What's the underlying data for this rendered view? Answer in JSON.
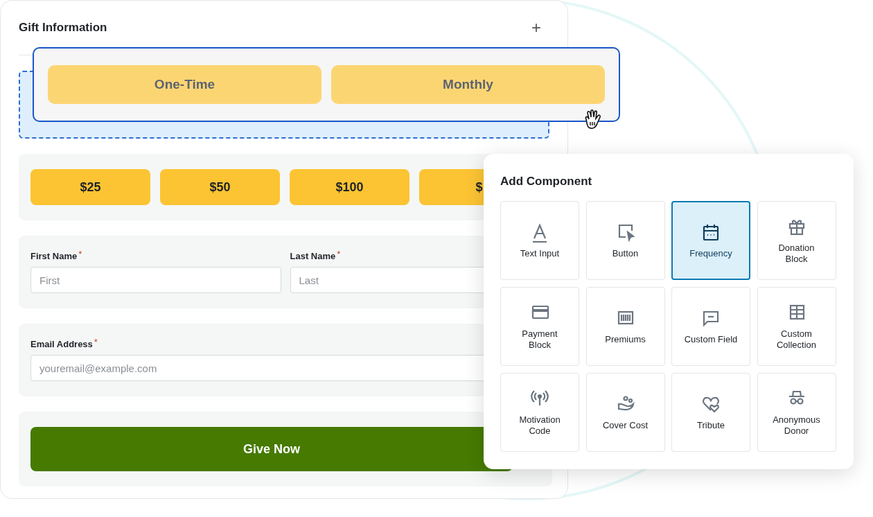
{
  "form": {
    "title": "Gift Information",
    "add_button": "+",
    "frequency_options": [
      {
        "label": "One-Time"
      },
      {
        "label": "Monthly"
      }
    ],
    "amounts": [
      {
        "label": "$25"
      },
      {
        "label": "$50"
      },
      {
        "label": "$100"
      },
      {
        "label": "$"
      }
    ],
    "name_fields": [
      {
        "label": "First Name",
        "required_mark": "*",
        "placeholder": "First"
      },
      {
        "label": "Last Name",
        "required_mark": "*",
        "placeholder": "Last"
      }
    ],
    "email_field": {
      "label": "Email Address",
      "required_mark": "*",
      "placeholder": "youremail@example.com"
    },
    "submit": "Give Now"
  },
  "add_component": {
    "title": "Add Component",
    "items": [
      {
        "label": "Text Input",
        "kind": "text",
        "selected": false
      },
      {
        "label": "Button",
        "kind": "button",
        "selected": false
      },
      {
        "label": "Frequency",
        "kind": "calendar",
        "selected": true
      },
      {
        "label": "Donation Block",
        "kind": "gift",
        "selected": false
      },
      {
        "label": "Payment Block",
        "kind": "card",
        "selected": false
      },
      {
        "label": "Premiums",
        "kind": "barcode",
        "selected": false
      },
      {
        "label": "Custom Field",
        "kind": "comment",
        "selected": false
      },
      {
        "label": "Custom Collection",
        "kind": "grid",
        "selected": false
      },
      {
        "label": "Motivation Code",
        "kind": "broadcast",
        "selected": false
      },
      {
        "label": "Cover Cost",
        "kind": "hand",
        "selected": false
      },
      {
        "label": "Tribute",
        "kind": "hearts",
        "selected": false
      },
      {
        "label": "Anonymous Donor",
        "kind": "incognito",
        "selected": false
      }
    ]
  }
}
